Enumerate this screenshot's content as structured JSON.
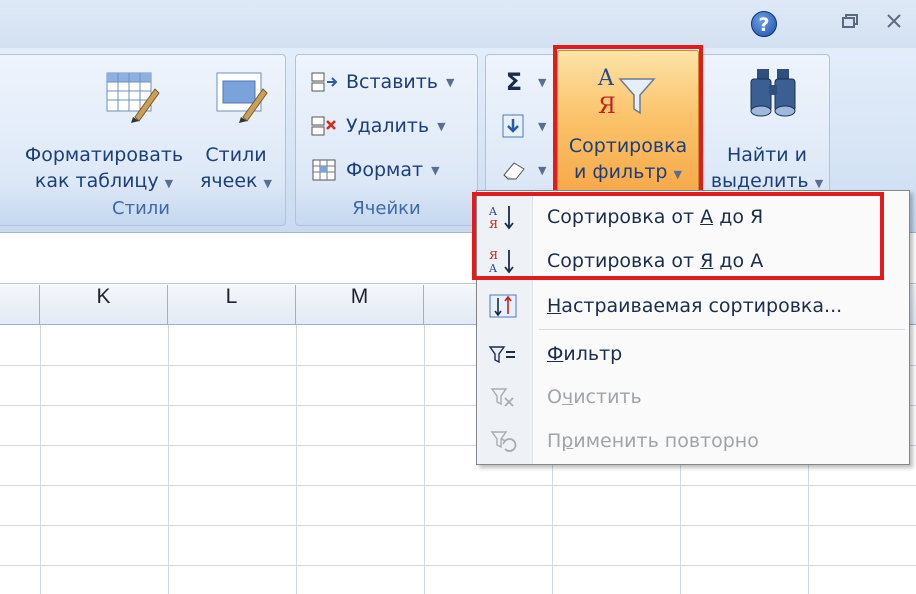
{
  "titlebar": {
    "help": "?"
  },
  "ribbon": {
    "styles_group": {
      "label": "Стили",
      "format_table": {
        "line1": "Форматировать",
        "line2": "как таблицу"
      },
      "cell_styles": {
        "line1": "Стили",
        "line2": "ячеек"
      }
    },
    "cells_group": {
      "label": "Ячейки",
      "insert": "Вставить",
      "delete": "Удалить",
      "format": "Формат"
    },
    "editing_group": {
      "sum_symbol": "Σ",
      "sort_filter": {
        "line1": "Сортировка",
        "line2": "и фильтр"
      },
      "find_select": {
        "line1": "Найти и",
        "line2": "выделить"
      }
    }
  },
  "columns": [
    "K",
    "L",
    "M"
  ],
  "menu": {
    "sort_az": {
      "pre": "Сортировка от ",
      "u": "А",
      "post": " до Я"
    },
    "sort_za": {
      "pre": "Сортировка от ",
      "u": "Я",
      "post": " до А"
    },
    "custom_sort": {
      "u": "Н",
      "rest": "астраиваемая сортировка..."
    },
    "filter": {
      "u": "Ф",
      "rest": "ильтр"
    },
    "clear": {
      "pre": "О",
      "u": "ч",
      "post": "истить"
    },
    "reapply": {
      "pre": "П",
      "u": "р",
      "post": "именить повторно"
    }
  },
  "colors": {
    "highlight": "#e41b1b",
    "sort_button": "#f7a94a"
  }
}
